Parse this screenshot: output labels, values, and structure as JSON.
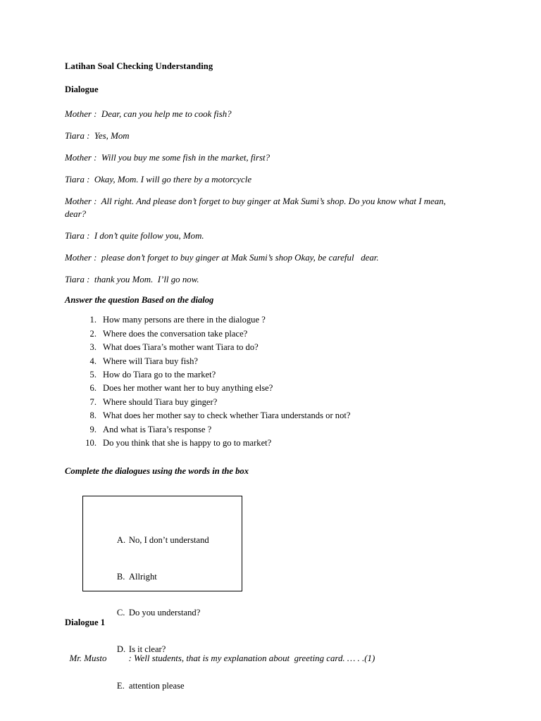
{
  "document": {
    "title": "Latihan Soal Checking Understanding",
    "dialogue_heading": "Dialogue"
  },
  "dialogue": {
    "lines": [
      "Mother :  Dear, can you help me to cook fish?",
      "Tiara :  Yes, Mom",
      "Mother :  Will you buy me some fish in the market, first?",
      "Tiara :  Okay, Mom. I will go there by a motorcycle",
      "Mother :  All right. And please don’t forget to buy ginger at Mak Sumi’s shop. Do you know what I mean, dear?",
      "Tiara :  I don’t quite follow you, Mom.",
      "Mother :  please don’t forget to buy ginger at Mak Sumi’s shop Okay, be careful   dear.",
      "Tiara :  thank you Mom.  I’ll go now."
    ]
  },
  "questions_section": {
    "heading": "Answer the question Based on the dialog",
    "items": [
      {
        "number": "1.",
        "text": "How many persons are there in the dialogue ?"
      },
      {
        "number": "2.",
        "text": "Where does the conversation take place?"
      },
      {
        "number": "3.",
        "text": "What does Tiara’s mother want Tiara to do?"
      },
      {
        "number": "4.",
        "text": "Where will Tiara buy fish?"
      },
      {
        "number": "5.",
        "text": "How do Tiara go to the market?"
      },
      {
        "number": "6.",
        "text": "Does her mother want her to buy anything else?"
      },
      {
        "number": "7.",
        "text": "Where should Tiara buy ginger?"
      },
      {
        "number": "8.",
        "text": "What does her mother say to check whether Tiara understands or not?"
      },
      {
        "number": "9.",
        "text": "And what is Tiara’s response ?"
      },
      {
        "number": "10.",
        "text": "Do you think that she is happy to go to market?"
      }
    ]
  },
  "complete_section": {
    "heading": "Complete the dialogues using the words in the box",
    "box_options": [
      {
        "letter": "A.",
        "text": "No, I don’t understand"
      },
      {
        "letter": "B.",
        "text": "Allright"
      },
      {
        "letter": "C.",
        "text": "Do you understand?"
      },
      {
        "letter": "D.",
        "text": "Is it clear?"
      },
      {
        "letter": "E.",
        "text": "attention please"
      }
    ]
  },
  "dialogue_one": {
    "heading": "Dialogue 1",
    "speaker": "Mr. Musto",
    "text": ": Well students, that is my explanation about  greeting card. … . .(1)"
  },
  "colors": {
    "page_background": "#ffffff",
    "text": "#000000",
    "box_border": "#000000"
  }
}
